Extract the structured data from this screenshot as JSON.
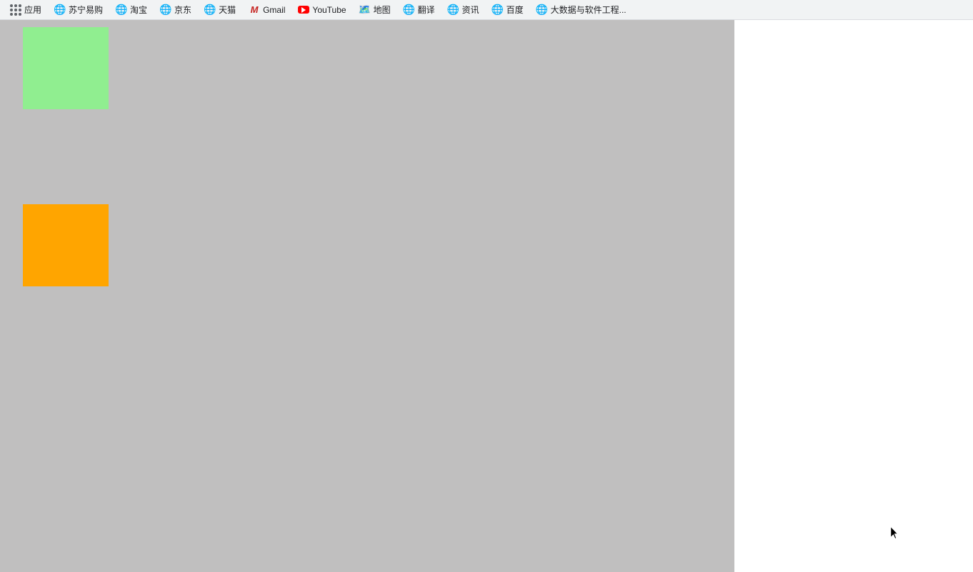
{
  "bookmarks": {
    "items": [
      {
        "id": "apps",
        "label": "应用",
        "icon_type": "apps"
      },
      {
        "id": "suning",
        "label": "苏宁易购",
        "icon_type": "globe"
      },
      {
        "id": "taobao",
        "label": "淘宝",
        "icon_type": "globe"
      },
      {
        "id": "jingdong",
        "label": "京东",
        "icon_type": "globe"
      },
      {
        "id": "tianmao",
        "label": "天猫",
        "icon_type": "globe"
      },
      {
        "id": "gmail",
        "label": "Gmail",
        "icon_type": "gmail"
      },
      {
        "id": "youtube",
        "label": "YouTube",
        "icon_type": "youtube"
      },
      {
        "id": "ditu",
        "label": "地图",
        "icon_type": "maps"
      },
      {
        "id": "fanyi",
        "label": "翻译",
        "icon_type": "globe"
      },
      {
        "id": "zixun",
        "label": "资讯",
        "icon_type": "globe"
      },
      {
        "id": "baidu",
        "label": "百度",
        "icon_type": "globe"
      },
      {
        "id": "bigdata",
        "label": "大数据与软件工程...",
        "icon_type": "globe"
      }
    ]
  },
  "main": {
    "background_color": "#c0bfbf",
    "green_rect_color": "#90ee90",
    "orange_rect_color": "#ffa500"
  }
}
